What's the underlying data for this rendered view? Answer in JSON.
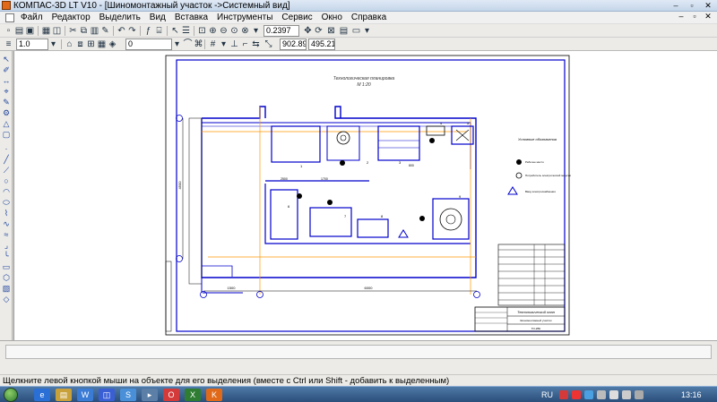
{
  "window": {
    "title": "КОМПАС-3D LT V10 - [Шиномонтажный участок ->Системный вид]",
    "controls": {
      "minimize": "–",
      "restore": "▫",
      "close": "✕"
    }
  },
  "menubar": {
    "items": [
      "Файл",
      "Редактор",
      "Выделить",
      "Вид",
      "Вставка",
      "Инструменты",
      "Сервис",
      "Окно",
      "Справка"
    ],
    "doc_controls": {
      "minimize": "–",
      "restore": "▫",
      "close": "✕"
    }
  },
  "toolbar": {
    "zoom_value": "0.2397",
    "line_style": "1.0",
    "layer": "0",
    "cursor_x": "902.89",
    "cursor_y": "495.213"
  },
  "drawing": {
    "title_line1": "Технологическая планировка",
    "title_line2": "М 1:20",
    "legend_title": "Условные обозначения",
    "legend_items": [
      "Рабочее место",
      "Потребитель электрической энергии",
      "Ввод электроснабжения"
    ],
    "dim_total": "6000",
    "dim_left": "1500",
    "dim_height": "4500",
    "dim_a": "2500",
    "dim_b": "1700",
    "dim_c": "800",
    "stamp_title": "Технологический план",
    "stamp_subtitle": "Шиномонтажный участок",
    "stamp_code": "ТО-2ВК",
    "equipment_labels": [
      "1",
      "2",
      "3",
      "4",
      "5",
      "6",
      "7",
      "8",
      "9"
    ]
  },
  "status": {
    "hint": "Щелкните левой кнопкой мыши на объекте для его выделения (вместе с Ctrl или Shift - добавить к выделенным)"
  },
  "taskbar": {
    "language": "RU",
    "time": "13:16"
  }
}
